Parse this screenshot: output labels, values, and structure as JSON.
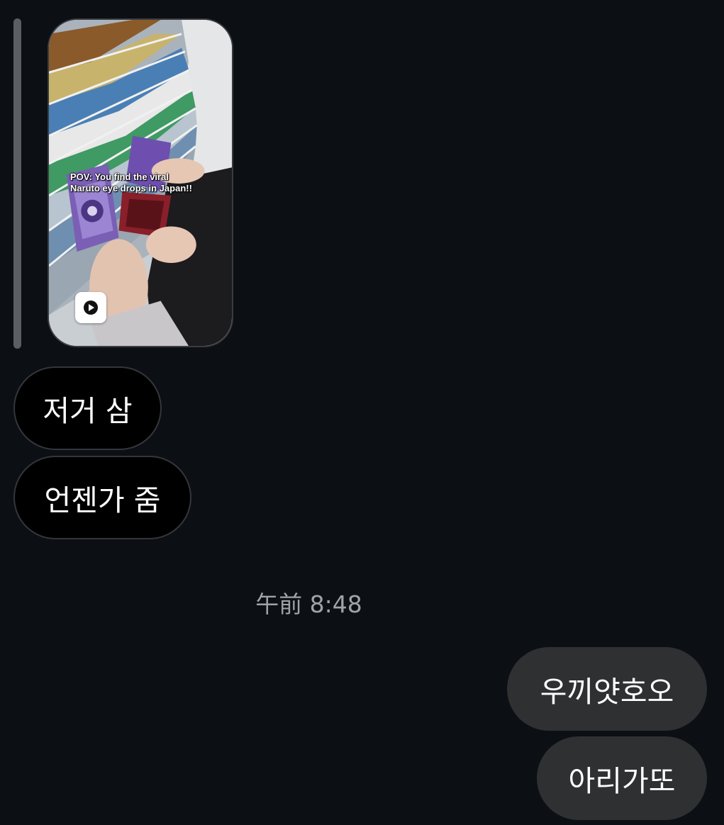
{
  "media": {
    "caption_line1": "POV: You find the viral",
    "caption_line2": "Naruto eye drops in Japan!!",
    "play_icon": "play-icon",
    "reply_indicator": "reply-bar"
  },
  "messages_received": [
    {
      "text": "저거 삼"
    },
    {
      "text": "언젠가 줌"
    }
  ],
  "timestamp": "午前 8:48",
  "messages_sent": [
    {
      "text": "우끼얏호오"
    },
    {
      "text": "아리가또"
    }
  ],
  "colors": {
    "background": "#0c0f14",
    "received_bubble": "#000000",
    "received_border": "#33363b",
    "sent_bubble": "#2f3032",
    "timestamp_text": "#9fa3a9",
    "text": "#ffffff"
  }
}
